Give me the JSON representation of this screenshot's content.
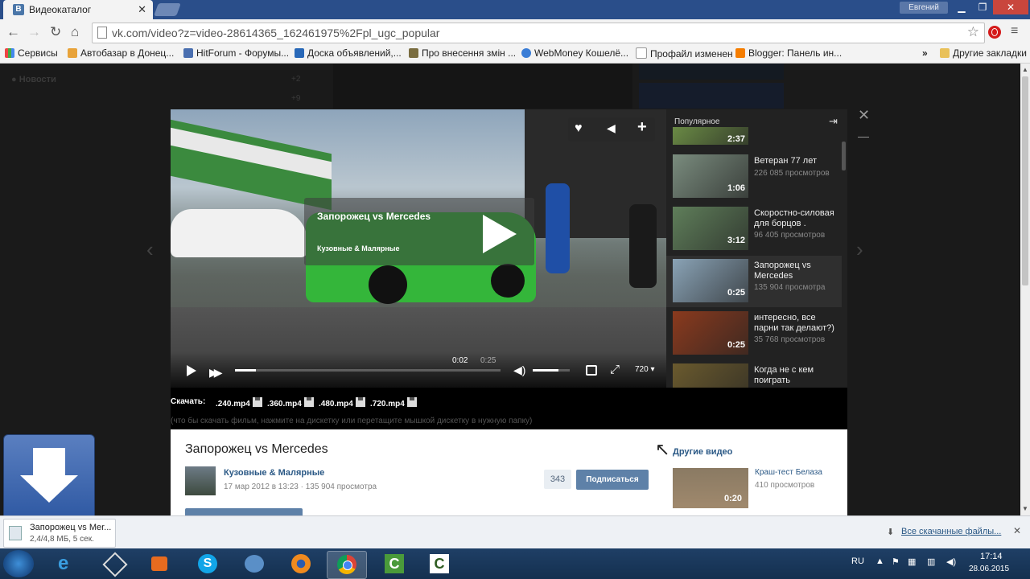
{
  "browser": {
    "tab_title": "Видеокаталог",
    "tab_close": "✕",
    "user_name": "Евгений",
    "url": "vk.com/video?z=video-28614365_162461975%2Fpl_ugc_popular",
    "bookmarks": [
      "Сервисы",
      "Автобазар в Донец...",
      "HitForum - Форумы...",
      "Доска объявлений,...",
      "Про внесення змін ...",
      "WebMoney Кошелё...",
      "Профайл изменен",
      "Blogger: Панель ин..."
    ],
    "bookmarks_more": "»",
    "other_bookmarks": "Другие закладки"
  },
  "background_page": {
    "menu_label": "Новости",
    "counters": [
      "+2",
      "+9"
    ]
  },
  "player": {
    "title": "Запорожец vs Mercedes",
    "channel": "Кузовные & Малярные",
    "current_time": "0:02",
    "duration": "0:25",
    "quality": "720",
    "progress": 0.08,
    "volume": 0.7
  },
  "sidebar": {
    "heading": "Популярное",
    "videos": [
      {
        "title": "",
        "views": "",
        "duration": "2:37",
        "color": "#6a8a45"
      },
      {
        "title": "Ветеран 77 лет",
        "views": "226 085 просмотров",
        "duration": "1:06",
        "color": "#7a8c7e"
      },
      {
        "title": "Скоростно-силовая для борцов .",
        "views": "96 405 просмотров",
        "duration": "3:12",
        "color": "#5f7e5a"
      },
      {
        "title": "Запорожец vs Mercedes",
        "views": "135 904 просмотра",
        "duration": "0:25",
        "color": "#8aa3b6"
      },
      {
        "title": "интересно, все парни так делают?)",
        "views": "35 768 просмотров",
        "duration": "0:25",
        "color": "#8a3a1e"
      },
      {
        "title": "Когда не с кем поиграть",
        "views": "",
        "duration": "",
        "color": "#6a5a2e"
      }
    ]
  },
  "downloads": {
    "label": "Скачать:",
    "files": [
      ".240.mp4",
      ".360.mp4",
      ".480.mp4",
      ".720.mp4"
    ],
    "hint": "(что бы скачать фильм, нажмите на дискетку или перетащите мышкой дискетку в нужную папку)"
  },
  "info": {
    "title": "Запорожец vs Mercedes",
    "channel": "Кузовные & Малярные",
    "meta": "17 мар 2012 в 13:23 · 135 904 просмотра",
    "subscribers": "343",
    "subscribe_label": "Подписаться",
    "other_videos_label": "Другие видео",
    "other_video": {
      "title": "Краш-тест Белаза",
      "views": "410 просмотров",
      "duration": "0:20"
    }
  },
  "download_shelf": {
    "file_name": "Запорожец vs Mer...",
    "file_status": "2,4/4,8 МБ, 5 сек.",
    "all_downloads": "Все скачанные файлы...",
    "close": "✕"
  },
  "taskbar": {
    "language": "RU",
    "time": "17:14",
    "date": "28.06.2015"
  },
  "colors": {
    "vk_blue": "#4a76a8",
    "link": "#2a5885",
    "chrome_frame": "#2a4e8a"
  }
}
